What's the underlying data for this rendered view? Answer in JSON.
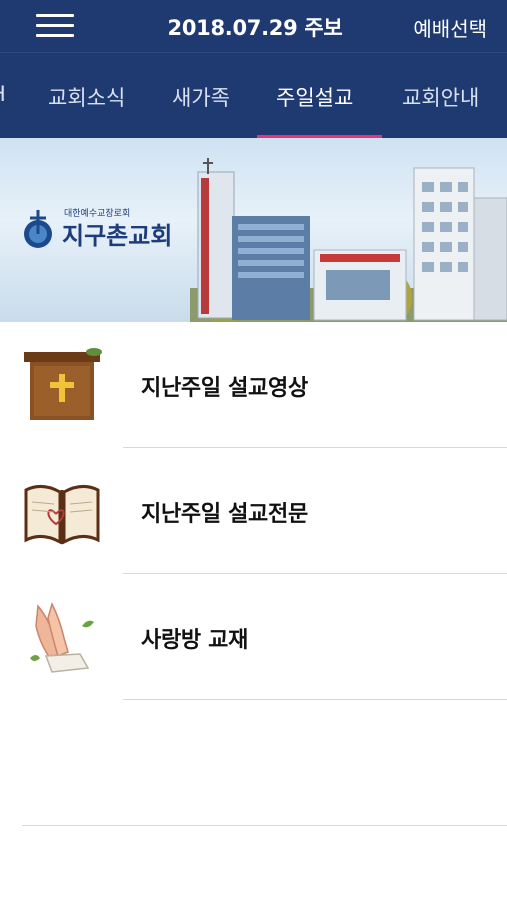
{
  "header": {
    "title": "2018.07.29 주보",
    "action_label": "예배선택"
  },
  "tabs": {
    "partial_left": "H",
    "items": [
      "교회소식",
      "새가족",
      "주일설교",
      "교회안내"
    ],
    "active_index": 2
  },
  "banner": {
    "denomination": "대한예수교장로회",
    "church_name": "지구촌교회"
  },
  "list": [
    {
      "label": "지난주일 설교영상",
      "icon": "pulpit-cross-icon"
    },
    {
      "label": "지난주일 설교전문",
      "icon": "open-bible-icon"
    },
    {
      "label": "사랑방 교재",
      "icon": "praying-hands-icon"
    }
  ],
  "colors": {
    "nav_background": "#1f3a70",
    "active_indicator": "#e8337a"
  }
}
